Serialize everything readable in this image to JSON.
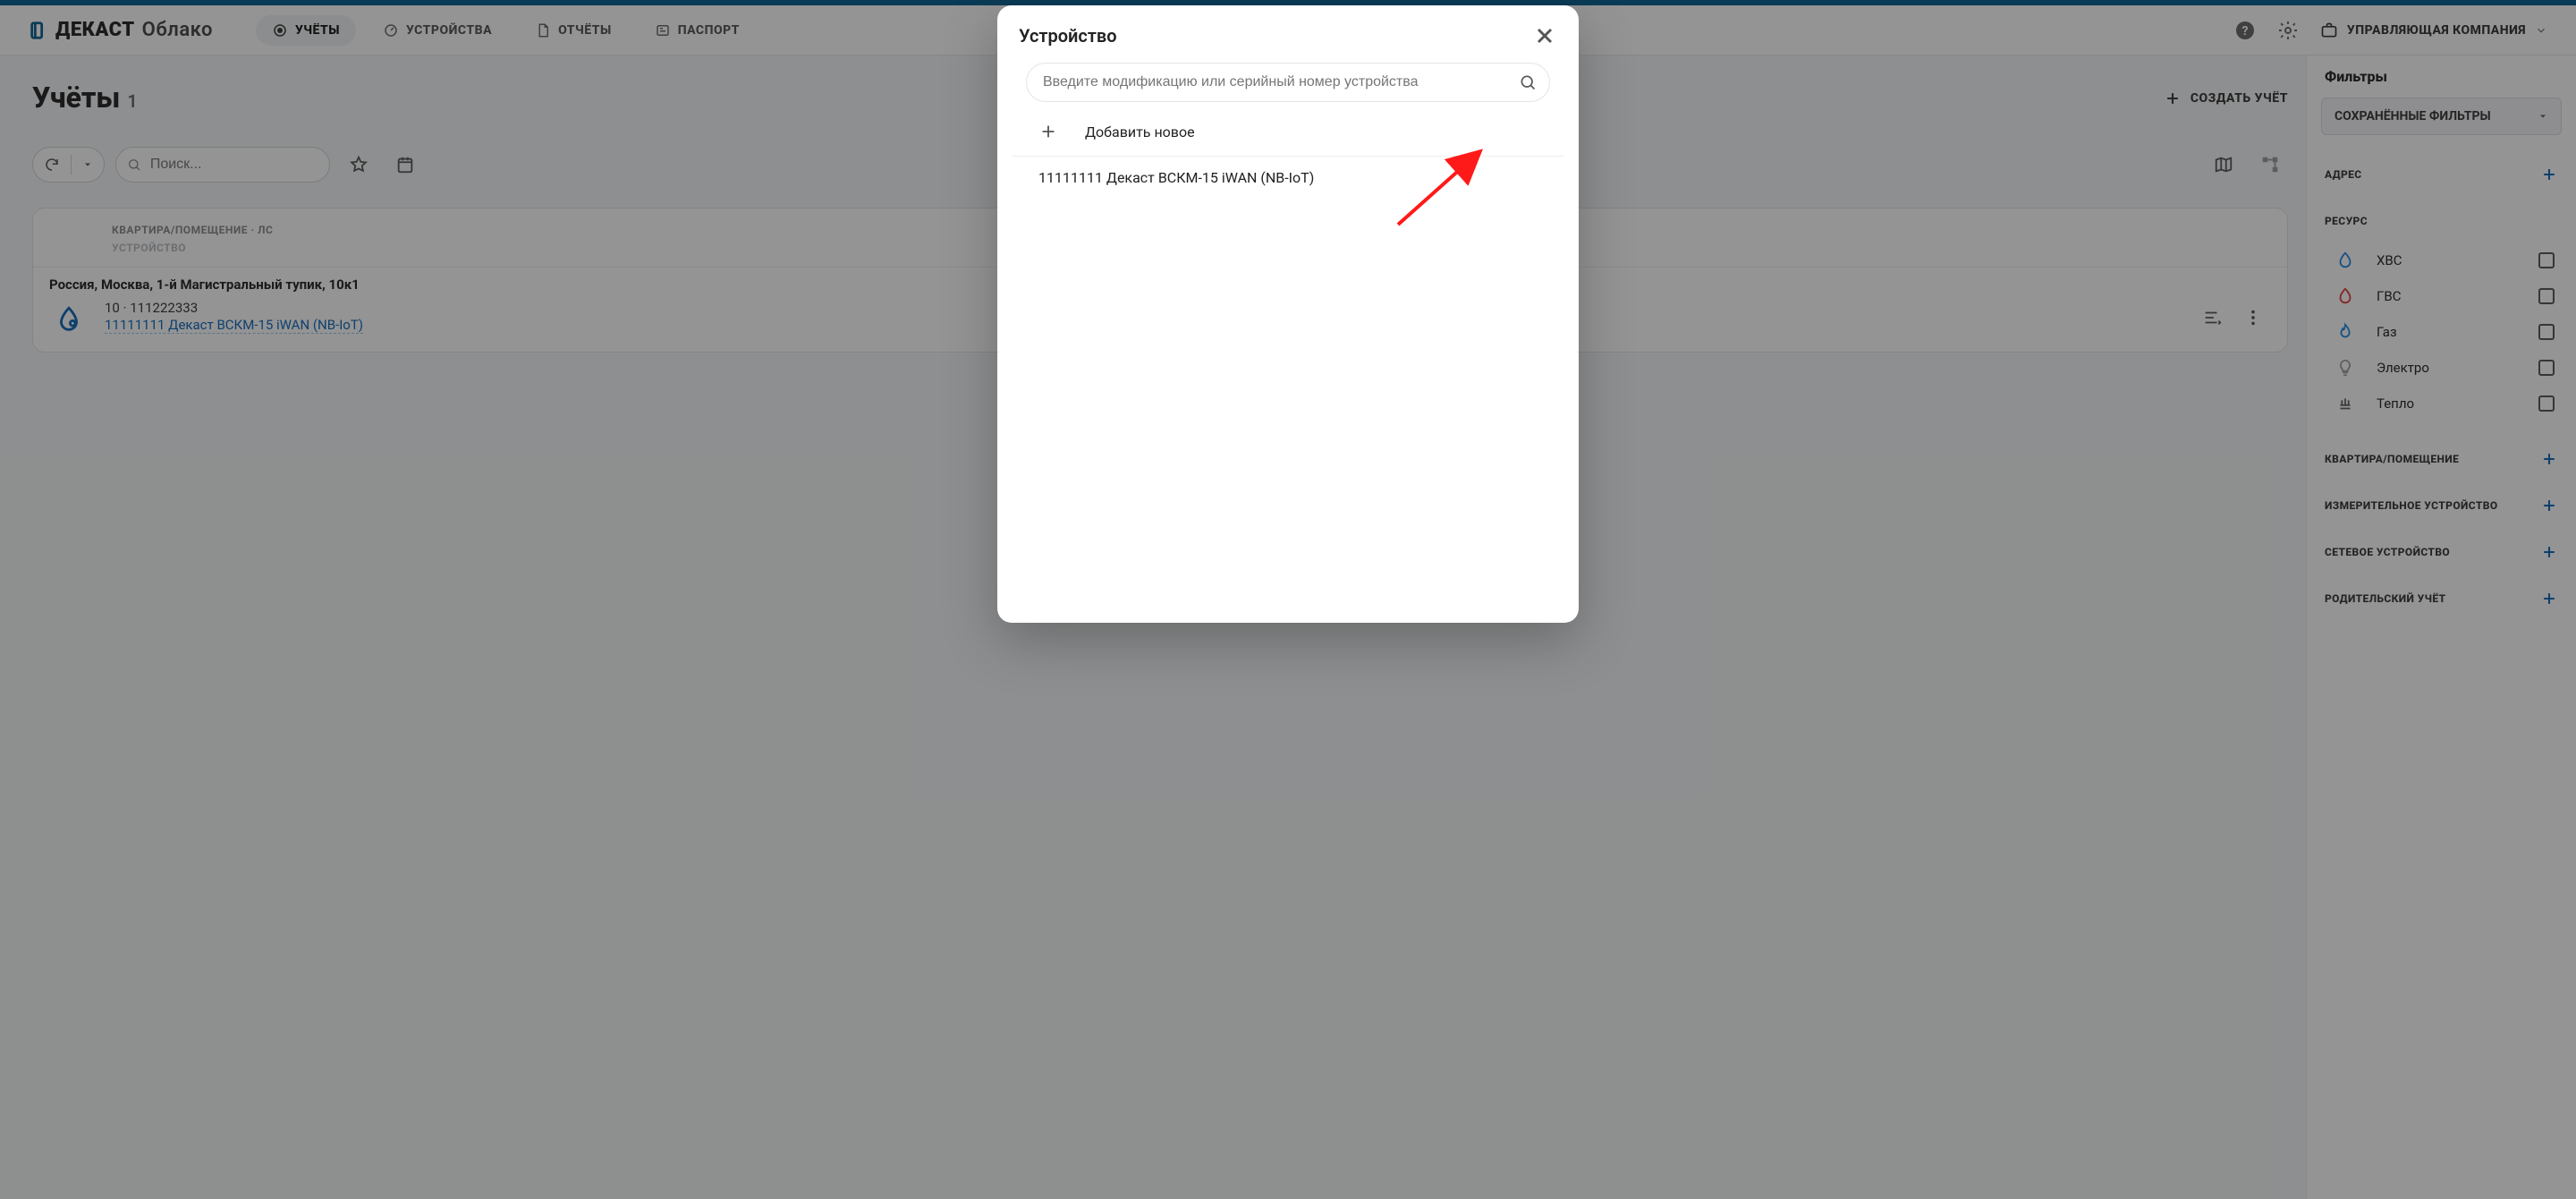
{
  "brand": {
    "name": "ДЕКАСТ",
    "suffix": "Облако"
  },
  "nav": {
    "items": [
      {
        "label": "УЧЁТЫ"
      },
      {
        "label": "УСТРОЙСТВА"
      },
      {
        "label": "ОТЧЁТЫ"
      },
      {
        "label": "ПАСПОРТ"
      }
    ]
  },
  "company": {
    "label": "УПРАВЛЯЮЩАЯ КОМПАНИЯ"
  },
  "page": {
    "title": "Учёты",
    "count": "1",
    "create_label": "СОЗДАТЬ УЧЁТ",
    "search_placeholder": "Поиск..."
  },
  "card": {
    "head1": "КВАРТИРА/ПОМЕЩЕНИЕ · ЛС",
    "head2": "УСТРОЙСТВО",
    "address": "Россия, Москва, 1-й Магистральный тупик, 10к1",
    "line1_a": "10",
    "line1_sep": " · ",
    "line1_b": "111222333",
    "device": "11111111 Декаст ВСКМ-15 iWAN (NB-IoT)"
  },
  "filters": {
    "title": "Фильтры",
    "saved_label": "СОХРАНЁННЫЕ ФИЛЬТРЫ",
    "sections": {
      "address": "АДРЕС",
      "resource": "РЕСУРС",
      "room": "КВАРТИРА/ПОМЕЩЕНИЕ",
      "metering": "ИЗМЕРИТЕЛЬНОЕ УСТРОЙСТВО",
      "network": "СЕТЕВОЕ УСТРОЙСТВО",
      "parent": "РОДИТЕЛЬСКИЙ УЧЁТ"
    },
    "resources": [
      {
        "label": "ХВС",
        "color": "#1e88e5"
      },
      {
        "label": "ГВС",
        "color": "#e53935"
      },
      {
        "label": "Газ",
        "color": "#1e88e5"
      },
      {
        "label": "Электро",
        "color": "#9e9e9e"
      },
      {
        "label": "Тепло",
        "color": "#616161"
      }
    ]
  },
  "modal": {
    "title": "Устройство",
    "search_placeholder": "Введите модификацию или серийный номер устройства",
    "add_label": "Добавить новое",
    "items": [
      "11111111 Декаст ВСКМ-15 iWAN (NB-IoT)"
    ]
  }
}
